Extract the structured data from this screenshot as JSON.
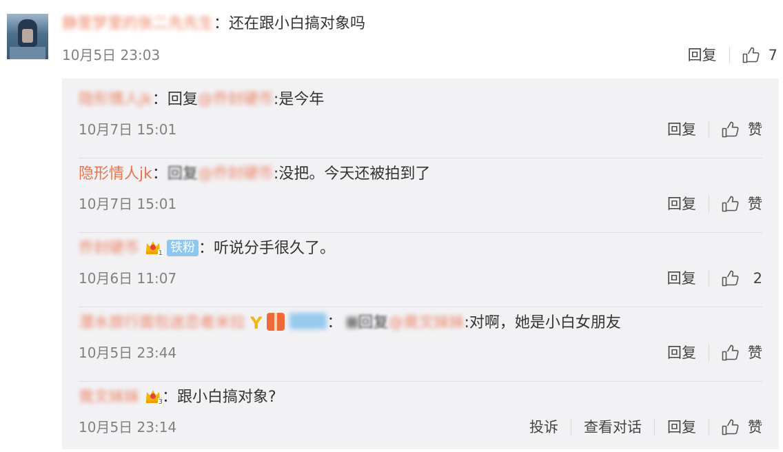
{
  "main_comment": {
    "username": "静里梦里的张二先先生",
    "separator": "：",
    "text": "还在跟小白搞对象吗",
    "time": "10月5日 23:03",
    "reply_label": "回复",
    "like_count": "7"
  },
  "replies": [
    {
      "username": "隐形情人jk",
      "separator": "：",
      "reply_prefix": "回复",
      "mention": "@乔封硬币",
      "text": ":是今年",
      "time": "10月7日 15:01",
      "reply_label": "回复",
      "like_label": "赞"
    },
    {
      "username": "隐形情人jk",
      "separator": "：",
      "reply_prefix": "回复",
      "mention": "@乔封硬币",
      "text": ":没把。今天还被拍到了",
      "time": "10月7日 15:01",
      "reply_label": "回复",
      "like_label": "赞"
    },
    {
      "username": "乔封硬币",
      "crown_level": "1",
      "fan_badge": "铁粉",
      "separator": "：",
      "text": "听说分手很久了。",
      "time": "10月6日 11:07",
      "reply_label": "回复",
      "like_label": "2"
    },
    {
      "username": "潜水旅行面包迷恋者米拉",
      "separator": "：",
      "reply_prefix": "回复",
      "mention": "@竟文妹妹",
      "text": ":对啊，她是小白女朋友",
      "time": "10月5日 23:44",
      "reply_label": "回复",
      "like_label": "赞"
    },
    {
      "username": "竟文妹妹",
      "crown_level": "3",
      "separator": "：",
      "text": "跟小白搞对象?",
      "time": "10月5日 23:14",
      "report_label": "投诉",
      "view_conversation_label": "查看对话",
      "reply_label": "回复",
      "like_label": "赞"
    }
  ],
  "colors": {
    "username": "#eb7350",
    "panel_bg": "#f2f2f5",
    "time": "#808080",
    "fan_badge": "#8fc6ee"
  }
}
